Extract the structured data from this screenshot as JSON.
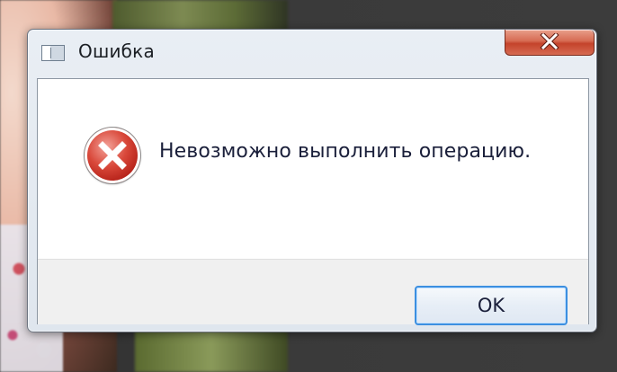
{
  "dialog": {
    "title": "Ошибка",
    "icon": "error-icon",
    "message": "Невозможно выполнить операцию.",
    "ok_label": "OK",
    "close_glyph": "x"
  },
  "colors": {
    "close_button": "#c4432b",
    "ok_border": "#3c8fe0",
    "error_icon": "#b21e16",
    "footer_bg": "#f0f0f0"
  }
}
